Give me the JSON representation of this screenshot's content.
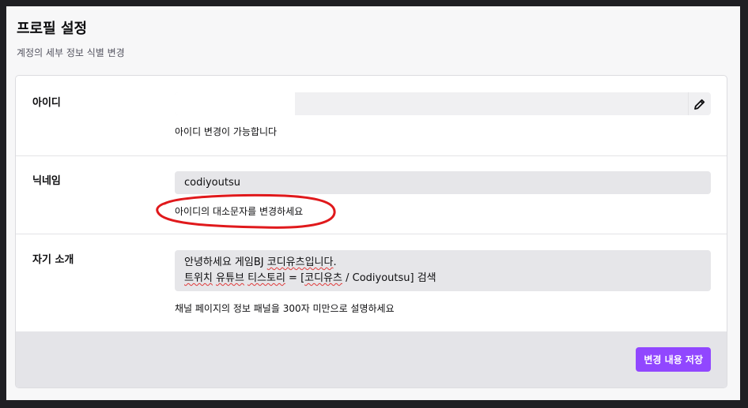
{
  "header": {
    "title": "프로필 설정",
    "subtitle": "계정의 세부 정보 식별 변경"
  },
  "username": {
    "label": "아이디",
    "value": "",
    "helper": "아이디 변경이 가능합니다",
    "edit_icon": "pencil-icon"
  },
  "nickname": {
    "label": "닉네임",
    "value": "codiyoutsu",
    "helper": "아이디의 대소문자를 변경하세요"
  },
  "bio": {
    "label": "자기 소개",
    "line1_a": "안녕하세요 게임BJ ",
    "line1_b": "코디유츠입니다",
    "line1_c": ".",
    "line2_a": "트위치",
    "line2_b": " ",
    "line2_c": "유튜브",
    "line2_d": " ",
    "line2_e": "티스토리",
    "line2_f": " = [",
    "line2_g": "코디유츠",
    "line2_h": " / Codiyoutsu] 검색",
    "helper": "채널 페이지의 정보 패널을 300자 미만으로 설명하세요"
  },
  "footer": {
    "save_label": "변경 내용 저장"
  },
  "colors": {
    "accent": "#9147ff",
    "annotation": "#e0191c",
    "spellcheck": "#e03a3a"
  }
}
